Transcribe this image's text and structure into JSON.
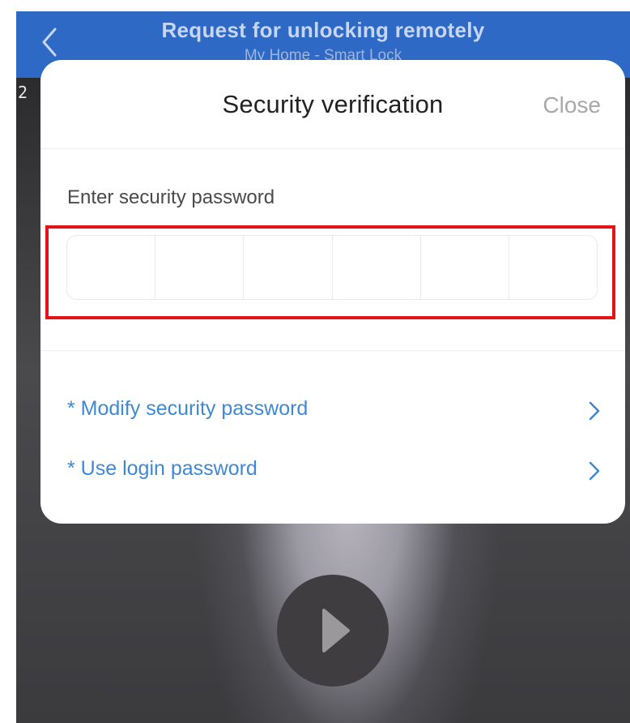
{
  "navbar": {
    "title": "Request for unlocking remotely",
    "subtitle": "My Home - Smart Lock",
    "back_icon": "chevron-left-icon"
  },
  "video": {
    "timestamp": "2",
    "play_icon": "play-icon"
  },
  "modal": {
    "title": "Security verification",
    "close_label": "Close",
    "password_label": "Enter security password",
    "pin_length": 6,
    "links": [
      {
        "label": "* Modify security password",
        "icon": "chevron-right-icon"
      },
      {
        "label": "* Use login password",
        "icon": "chevron-right-icon"
      }
    ]
  },
  "colors": {
    "nav_bg": "#2e69c5",
    "link": "#3e88d6",
    "highlight": "#e3121b"
  }
}
